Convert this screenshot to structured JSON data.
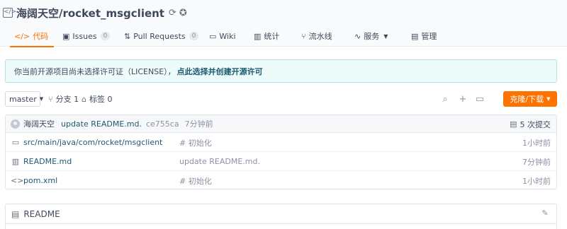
{
  "repo": {
    "title": "海阔天空/rocket_msgclient",
    "icons": [
      "repo-icon",
      "sync-icon",
      "badge-icon"
    ]
  },
  "tabs": [
    {
      "label": "代码",
      "icon": "code-icon",
      "active": true
    },
    {
      "label": "Issues",
      "icon": "issues-icon",
      "count": "0"
    },
    {
      "label": "Pull Requests",
      "icon": "pull-request-icon",
      "count": "0"
    },
    {
      "label": "Wiki",
      "icon": "wiki-icon"
    },
    {
      "label": "统计",
      "icon": "stats-icon"
    },
    {
      "label": "流水线",
      "icon": "pipeline-icon"
    },
    {
      "label": "服务",
      "icon": "service-icon",
      "dropdown": true
    },
    {
      "label": "管理",
      "icon": "manage-icon"
    }
  ],
  "notice": {
    "text": "你当前开源项目尚未选择许可证（LICENSE），",
    "link": "点此选择并创建开源许可"
  },
  "toolbar": {
    "branch": "master",
    "branches_label": "分支 1",
    "tags_label": "标签 0",
    "clone_label": "克隆/下载",
    "icons": [
      "search-icon",
      "plus-icon",
      "monitor-icon"
    ]
  },
  "commit": {
    "author": "海阔天空",
    "message": "update README.md.",
    "sha": "ce755ca",
    "time": "7分钟前",
    "count_label": "5 次提交"
  },
  "files": [
    {
      "icon": "folder-icon",
      "name": "src/main/java/com/rocket/msgclient",
      "message": "# 初始化",
      "time": "1小时前"
    },
    {
      "icon": "book-icon",
      "name": "README.md",
      "message": "update README.md.",
      "time": "7分钟前"
    },
    {
      "icon": "code-file-icon",
      "name": "pom.xml",
      "message": "# 初始化",
      "time": "1小时前"
    }
  ],
  "readme": {
    "title": "README"
  },
  "colors": {
    "accent": "#fe7300",
    "link": "#1d5a72",
    "notice_bg": "#eefbfb"
  }
}
